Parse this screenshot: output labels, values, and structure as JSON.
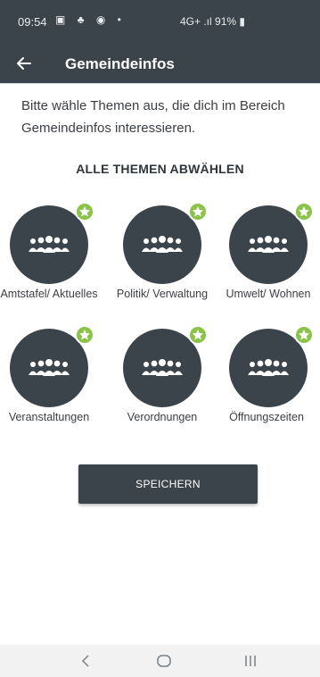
{
  "statusbar": {
    "time": "09:54",
    "icons": "▣ ♣ ◉ •",
    "network": "4G+ .ıl",
    "battery": "91%"
  },
  "appbar": {
    "title": "Gemeindeinfos"
  },
  "intro": "Bitte wähle Themen aus, die dich im Bereich Gemeindeinfos interessieren.",
  "deselect_all": "ALLE THEMEN ABWÄHLEN",
  "topics": [
    {
      "label": "Amtstafel/ Aktuelles",
      "selected": true
    },
    {
      "label": "Politik/ Verwaltung",
      "selected": true
    },
    {
      "label": "Umwelt/ Wohnen",
      "selected": true
    },
    {
      "label": "Veranstaltungen",
      "selected": true
    },
    {
      "label": "Verordnungen",
      "selected": true
    },
    {
      "label": "Öffnungszeiten",
      "selected": true
    }
  ],
  "save_label": "SPEICHERN",
  "colors": {
    "primary": "#3b444b",
    "badge": "#8bc34a",
    "background": "#ffffff"
  }
}
